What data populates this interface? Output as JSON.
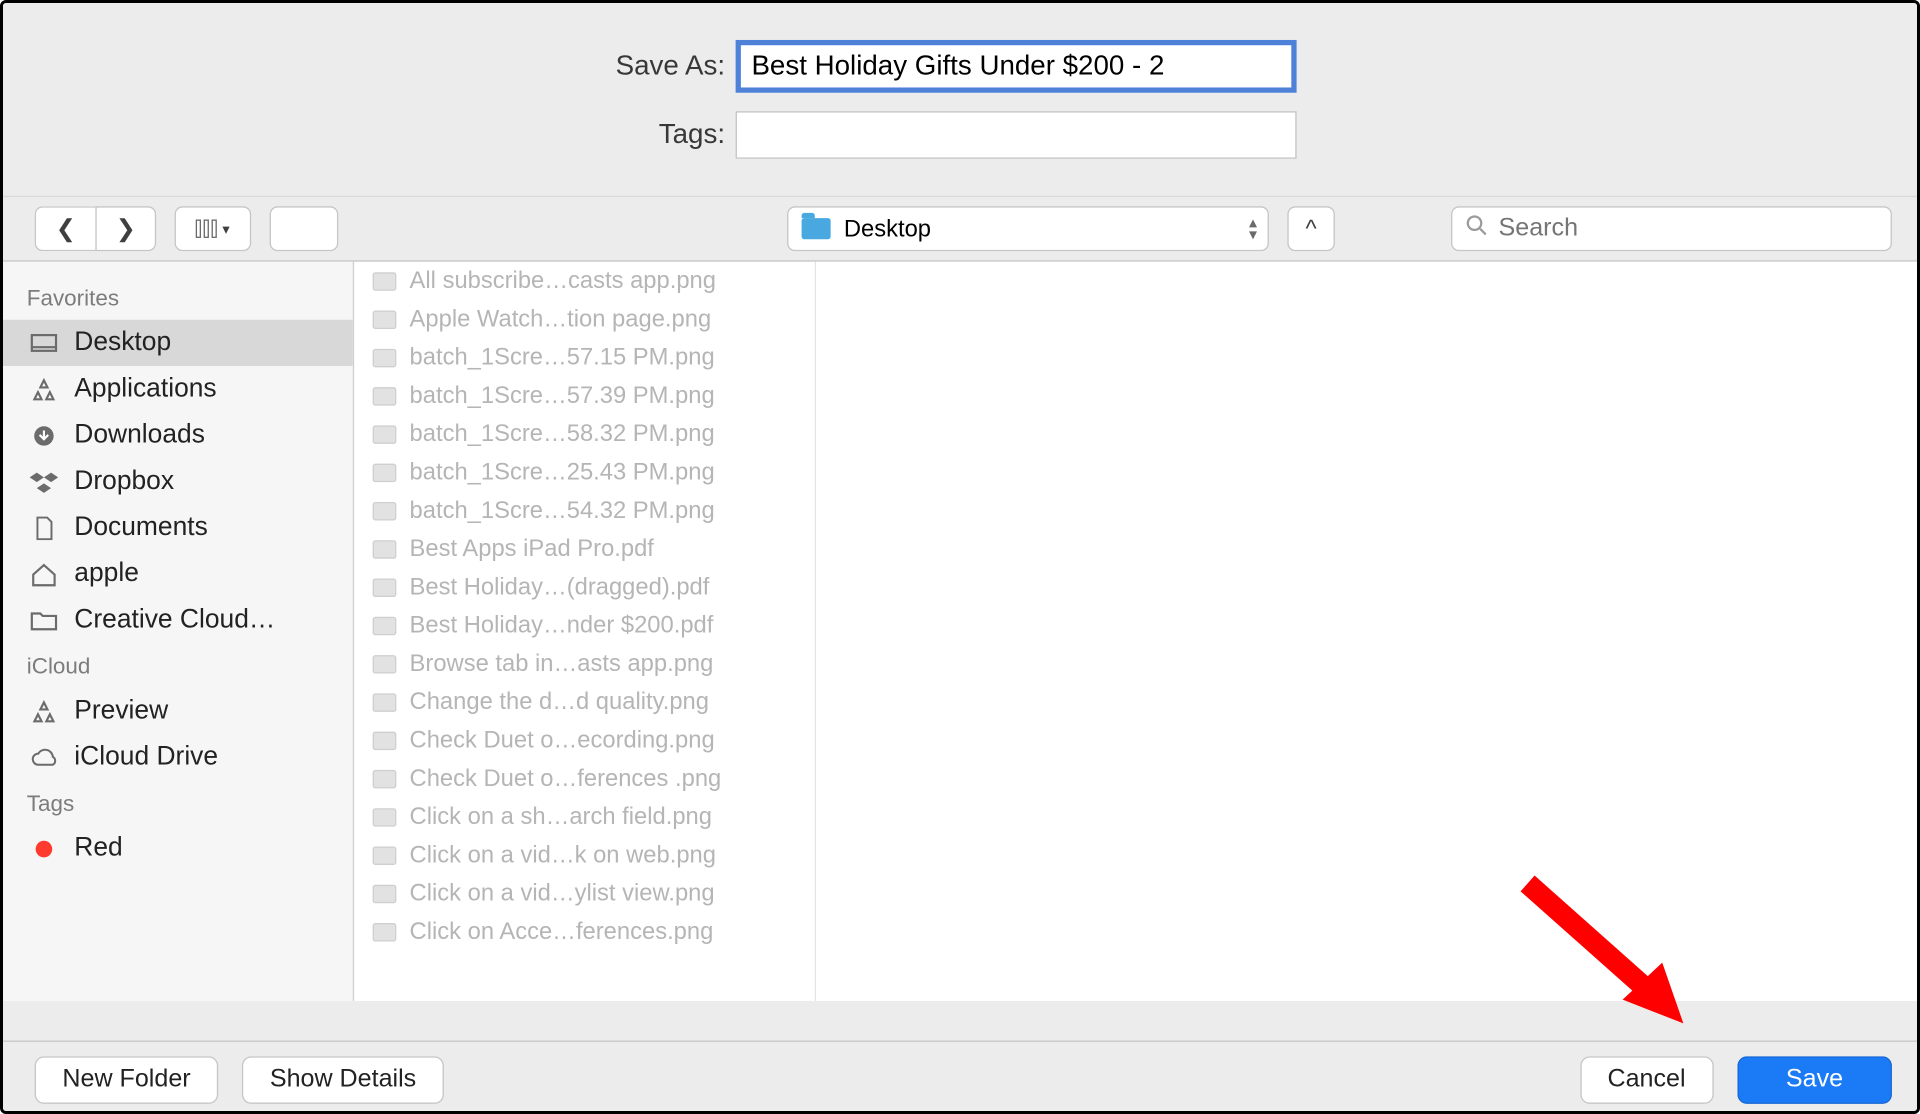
{
  "dialog": {
    "saveAsLabel": "Save As:",
    "saveAsValue": "Best Holiday Gifts Under $200 - 2",
    "tagsLabel": "Tags:",
    "tagsValue": "",
    "locationName": "Desktop",
    "searchPlaceholder": "Search"
  },
  "sidebar": {
    "groups": [
      {
        "name": "favorites",
        "label": "Favorites",
        "items": [
          {
            "id": "desktop",
            "label": "Desktop",
            "icon": "desktop",
            "selected": true
          },
          {
            "id": "applications",
            "label": "Applications",
            "icon": "apps"
          },
          {
            "id": "downloads",
            "label": "Downloads",
            "icon": "download"
          },
          {
            "id": "dropbox",
            "label": "Dropbox",
            "icon": "dropbox"
          },
          {
            "id": "documents",
            "label": "Documents",
            "icon": "doc"
          },
          {
            "id": "apple",
            "label": "apple",
            "icon": "home"
          },
          {
            "id": "creativecloud",
            "label": "Creative Cloud…",
            "icon": "folder"
          }
        ]
      },
      {
        "name": "icloud",
        "label": "iCloud",
        "items": [
          {
            "id": "preview",
            "label": "Preview",
            "icon": "apps"
          },
          {
            "id": "iclouddrive",
            "label": "iCloud Drive",
            "icon": "cloud"
          }
        ]
      },
      {
        "name": "tags",
        "label": "Tags",
        "items": [
          {
            "id": "red",
            "label": "Red",
            "icon": "reddot"
          }
        ]
      }
    ]
  },
  "files": [
    {
      "name": "All subscribe…casts app.png"
    },
    {
      "name": "Apple Watch…tion page.png"
    },
    {
      "name": "batch_1Scre…57.15 PM.png"
    },
    {
      "name": "batch_1Scre…57.39 PM.png"
    },
    {
      "name": "batch_1Scre…58.32 PM.png"
    },
    {
      "name": "batch_1Scre…25.43 PM.png"
    },
    {
      "name": "batch_1Scre…54.32 PM.png"
    },
    {
      "name": "Best Apps iPad Pro.pdf"
    },
    {
      "name": "Best Holiday…(dragged).pdf"
    },
    {
      "name": "Best Holiday…nder $200.pdf"
    },
    {
      "name": "Browse tab in…asts app.png"
    },
    {
      "name": "Change the d…d quality.png"
    },
    {
      "name": "Check Duet o…ecording.png"
    },
    {
      "name": "Check Duet o…ferences .png"
    },
    {
      "name": "Click on a sh…arch field.png"
    },
    {
      "name": "Click on a vid…k on web.png"
    },
    {
      "name": "Click on a vid…ylist view.png"
    },
    {
      "name": "Click on Acce…ferences.png"
    }
  ],
  "footer": {
    "newFolder": "New Folder",
    "showDetails": "Show Details",
    "cancel": "Cancel",
    "save": "Save"
  }
}
